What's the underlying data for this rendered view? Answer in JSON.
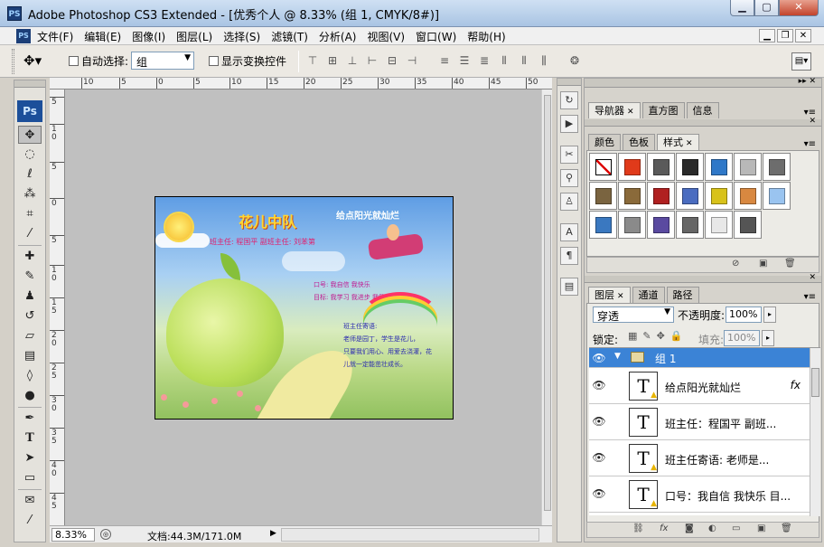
{
  "window": {
    "app_icon": "PS",
    "title": "Adobe Photoshop CS3 Extended - [优秀个人 @ 8.33% (组 1, CMYK/8#)]",
    "controls": [
      "minimize-icon",
      "maximize-icon",
      "close-icon"
    ]
  },
  "menubar": {
    "items": [
      "文件(F)",
      "编辑(E)",
      "图像(I)",
      "图层(L)",
      "选择(S)",
      "滤镜(T)",
      "分析(A)",
      "视图(V)",
      "窗口(W)",
      "帮助(H)"
    ]
  },
  "options": {
    "auto_select_label": "自动选择:",
    "auto_select_value": "组",
    "show_transform_label": "显示变换控件",
    "auto_select_checked": false,
    "show_transform_checked": false
  },
  "toolbox": {
    "logo": "Ps",
    "tools": [
      "move-tool-icon",
      "marquee-tool-icon",
      "lasso-tool-icon",
      "magic-wand-icon",
      "crop-tool-icon",
      "slice-tool-icon",
      "healing-brush-icon",
      "brush-tool-icon",
      "clone-stamp-icon",
      "history-brush-icon",
      "eraser-icon",
      "gradient-icon",
      "blur-icon",
      "dodge-icon",
      "pen-tool-icon",
      "type-tool-icon",
      "path-selection-icon",
      "shape-tool-icon",
      "notes-icon",
      "eyedropper-icon"
    ]
  },
  "ruler": {
    "top": [
      "10",
      "5",
      "0",
      "5",
      "10",
      "15",
      "20",
      "25",
      "30",
      "35",
      "40",
      "45",
      "50"
    ],
    "left": [
      "5",
      "1 0",
      "5",
      "0",
      "5",
      "1 0",
      "1 5",
      "2 0",
      "2 5",
      "3 0",
      "3 5",
      "4 0",
      "4 5",
      "5 0",
      "5 5"
    ]
  },
  "document": {
    "title": "花儿中队",
    "subtitle": "给点阳光就灿烂",
    "teacher_line": "班主任: 程国平  副班主任: 刘苯第",
    "slogan1": "口号: 我自信  我快乐",
    "slogan2": "目标: 我学习 我进步 我健康 我成长",
    "message_title": "班主任寄语:",
    "message_lines": [
      "老师是园丁，学生是花儿，",
      "只要我们用心、用爱去浇灌，花",
      "儿就一定能茁壮成长。"
    ]
  },
  "status": {
    "zoom": "8.33%",
    "doc_info": "文档:44.3M/171.0M"
  },
  "panels": {
    "nav_tabs": [
      "导航器",
      "直方图",
      "信息"
    ],
    "style_tabs": [
      "颜色",
      "色板",
      "样式"
    ],
    "swatch_colors": [
      "#ffffff",
      "#e03a1a",
      "#5a5a5a",
      "#2a2a2a",
      "#2f78c8",
      "#b8b8b8",
      "#6d6d6d",
      "#7a6440",
      "#8a6a3a",
      "#b02020",
      "#4a6cc0",
      "#d8c21a",
      "#d88840",
      "#9ac4f0",
      "#3a78c0",
      "#8a8a8a",
      "#5a4aa0",
      "#666666",
      "#e8e8e8",
      "#555555"
    ],
    "layers_tabs": [
      "图层",
      "通道",
      "路径"
    ],
    "blend_mode": "穿透",
    "opacity_label": "不透明度:",
    "opacity_value": "100%",
    "lock_label": "锁定:",
    "fill_label": "填充:",
    "fill_value": "100%",
    "layers": [
      {
        "name": "组 1",
        "type": "group"
      },
      {
        "name": "给点阳光就灿烂",
        "type": "text",
        "fx": "fx"
      },
      {
        "name": "班主任：程国平    副班...",
        "type": "text"
      },
      {
        "name": "班主任寄语:     老师是...",
        "type": "text"
      },
      {
        "name": "口号：我自信  我快乐 目...",
        "type": "text"
      }
    ]
  }
}
